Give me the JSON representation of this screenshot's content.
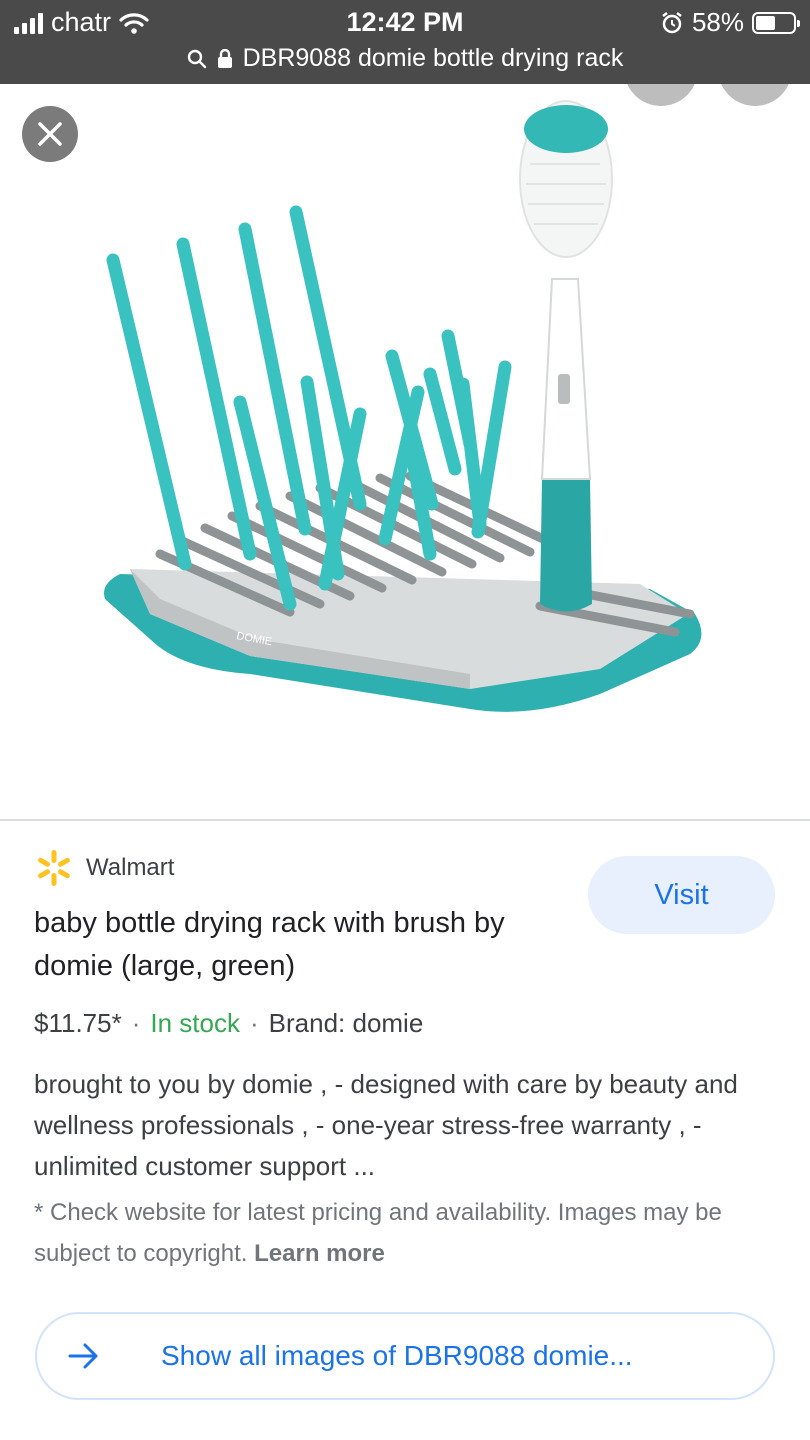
{
  "status_bar": {
    "carrier": "chatr",
    "time": "12:42 PM",
    "battery": "58%",
    "battery_level": 0.58,
    "url_title": "DBR9088 domie bottle drying rack"
  },
  "image_viewer": {
    "close_icon": "close-icon",
    "image_brand_text": "DOMIE"
  },
  "result": {
    "source": "Walmart",
    "visit_label": "Visit",
    "title": "baby bottle drying rack with brush by domie (large, green)",
    "price": "$11.75*",
    "stock": "In stock",
    "brand": "Brand: domie",
    "description": "brought to you by domie , - designed with care by beauty and wellness professionals , - one-year stress-free warranty , - unlimited customer support ...",
    "disclaimer": "* Check website for latest pricing and availability. Images may be subject to copyright.",
    "learn_more": "Learn more",
    "show_all_label": "Show all images of DBR9088 domie..."
  },
  "colors": {
    "accent": "#1a73e8",
    "in_stock": "#34a853",
    "rack_teal": "#2fb5b4",
    "status_bar_bg": "#4a4a4a"
  }
}
